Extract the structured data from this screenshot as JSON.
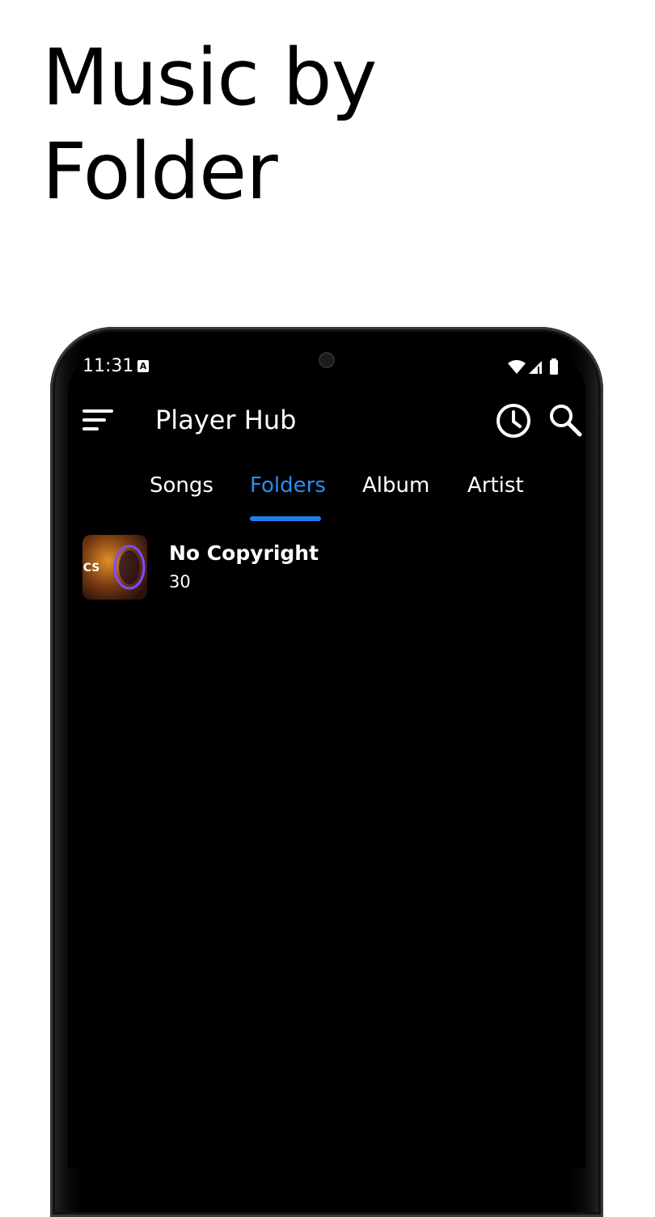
{
  "promo": {
    "title": "Music by Folder"
  },
  "status_bar": {
    "time": "11:31",
    "notification_icon": "A"
  },
  "app_bar": {
    "title": "Player Hub",
    "menu_icon": "sort-menu-icon",
    "history_icon": "history-clock-icon",
    "search_icon": "search-icon"
  },
  "tabs": [
    {
      "label": "Songs",
      "active": false
    },
    {
      "label": "Folders",
      "active": true
    },
    {
      "label": "Album",
      "active": false
    },
    {
      "label": "Artist",
      "active": false
    }
  ],
  "folders": [
    {
      "name": "No Copyright",
      "count": "30",
      "thumb_text": "NCS"
    }
  ],
  "colors": {
    "accent": "#1f7fe8",
    "background": "#000000",
    "text": "#ffffff"
  }
}
